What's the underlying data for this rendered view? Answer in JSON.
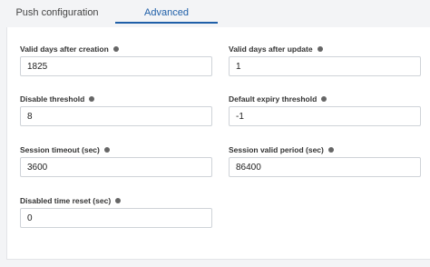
{
  "tabs": [
    {
      "label": "Push configuration",
      "active": false
    },
    {
      "label": "Advanced",
      "active": true
    }
  ],
  "accent_color": "#1f5fa8",
  "fields": [
    {
      "label": "Valid days after creation",
      "value": "1825",
      "icon": "info-icon"
    },
    {
      "label": "Valid days after update",
      "value": "1",
      "icon": "info-icon"
    },
    {
      "label": "Disable threshold",
      "value": "8",
      "icon": "info-icon"
    },
    {
      "label": "Default expiry threshold",
      "value": "-1",
      "icon": "info-icon"
    },
    {
      "label": "Session timeout (sec)",
      "value": "3600",
      "icon": "info-icon"
    },
    {
      "label": "Session valid period (sec)",
      "value": "86400",
      "icon": "info-icon"
    },
    {
      "label": "Disabled time reset (sec)",
      "value": "0",
      "icon": "info-icon"
    }
  ]
}
